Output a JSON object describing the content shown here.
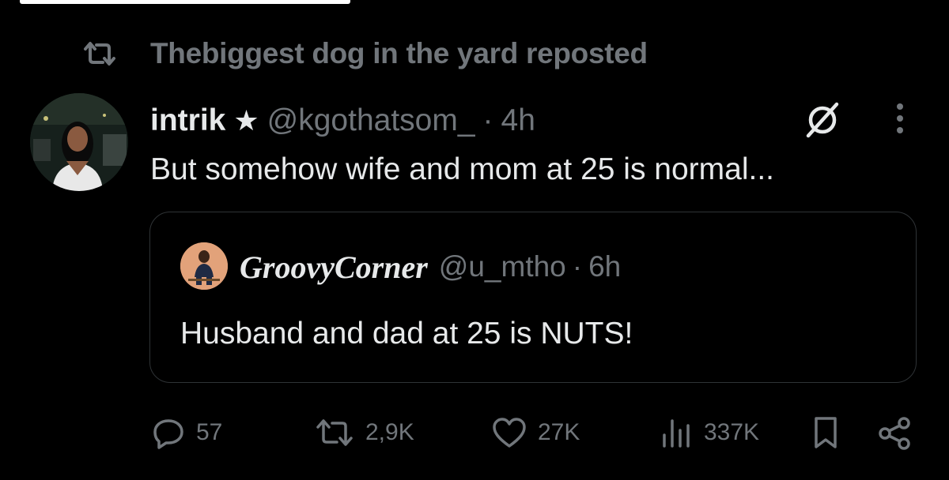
{
  "repost": {
    "text": "Thebiggest dog in the yard reposted",
    "icon": "repost-icon"
  },
  "tweet": {
    "name": "intrik",
    "badge": "★",
    "handle": "@kgothatsom_",
    "separator": "·",
    "time": "4h",
    "text": "But somehow wife and mom at 25 is normal...",
    "icons": [
      "mute-icon",
      "more-options-icon"
    ]
  },
  "quote": {
    "name": "GroovyCorner",
    "handle": "@u_mtho",
    "separator": "·",
    "time": "6h",
    "text": "Husband and dad at 25 is NUTS!"
  },
  "actions": {
    "replies": "57",
    "reposts": "2,9K",
    "likes": "27K",
    "views": "337K",
    "icons": [
      "reply-icon",
      "repost-icon",
      "like-icon",
      "views-icon",
      "bookmark-icon",
      "share-icon"
    ]
  },
  "colors": {
    "background": "#000000",
    "text": "#e7e9ea",
    "secondary": "#71767b",
    "border": "#2f3336"
  }
}
